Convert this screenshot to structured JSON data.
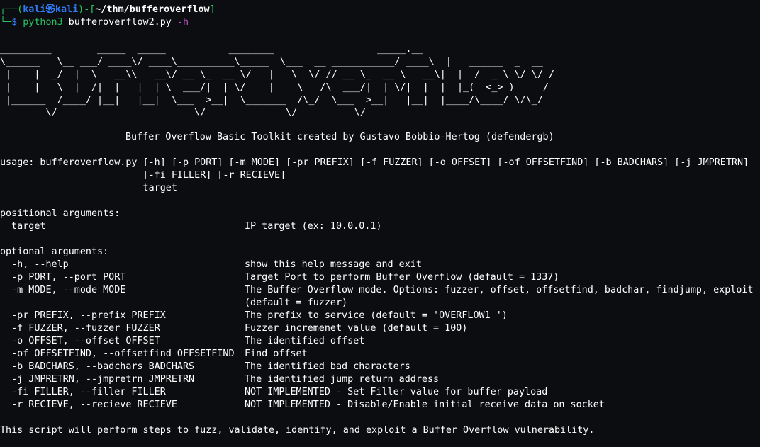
{
  "prompt": {
    "corner_top": "┌──(",
    "user": "kali",
    "at": "㉿",
    "host": "kali",
    "bracket_mid": ")-[",
    "cwd": "~/thm/bufferoverflow",
    "bracket_end": "]",
    "corner_bottom": "└─",
    "dollar": "$",
    "command": "python3",
    "file": "bufferoverflow2.py",
    "flag": "-h"
  },
  "banner": {
    "ascii": [
      "_________        _____  _____           ________                  _____.__",
      "\\______   \\__ ___/ ____\\/ ____\\__________\\_____  \\___  __ ___________/ ____\\  |   ______  _  __",
      " |    |  _/  |  \\   __\\\\   __\\/ __ \\_  __ \\/   |   \\  \\/ // __ \\_  __ \\   __\\|  |  /  _ \\ \\/ \\/ /",
      " |    |   \\  |  /|  |   |  | \\  ___/|  | \\/    |    \\   /\\  ___/|  | \\/|  |  |  |_(  <_> )     /",
      " |______  /____/ |__|   |__|  \\___  >__|  \\_______  /\\_/  \\___  >__|   |__|  |____/\\____/ \\/\\_/",
      "        \\/                        \\/              \\/          \\/"
    ],
    "credit": "Buffer Overflow Basic Toolkit created by Gustavo Bobbio-Hertog (defendergb)"
  },
  "usage": {
    "line1": "usage: bufferoverflow.py [-h] [-p PORT] [-m MODE] [-pr PREFIX] [-f FUZZER] [-o OFFSET] [-of OFFSETFIND] [-b BADCHARS] [-j JMPRETRN]",
    "line2": "                         [-fi FILLER] [-r RECIEVE]",
    "line3": "                         target"
  },
  "positional": {
    "header": "positional arguments:",
    "args": [
      {
        "name": "  target",
        "desc": "IP target (ex: 10.0.0.1)"
      }
    ]
  },
  "optional": {
    "header": "optional arguments:",
    "args": [
      {
        "name": "  -h, --help",
        "desc": "show this help message and exit"
      },
      {
        "name": "  -p PORT, --port PORT",
        "desc": "Target Port to perform Buffer Overflow (default = 1337)"
      },
      {
        "name": "  -m MODE, --mode MODE",
        "desc": "The Buffer Overflow mode. Options: fuzzer, offset, offsetfind, badchar, findjump, exploit"
      },
      {
        "name": "",
        "desc": "(default = fuzzer)"
      },
      {
        "name": "  -pr PREFIX, --prefix PREFIX",
        "desc": "The prefix to service (default = 'OVERFLOW1 ')"
      },
      {
        "name": "  -f FUZZER, --fuzzer FUZZER",
        "desc": "Fuzzer incremenet value (default = 100)"
      },
      {
        "name": "  -o OFFSET, --offset OFFSET",
        "desc": "The identified offset"
      },
      {
        "name": "  -of OFFSETFIND, --offsetfind OFFSETFIND",
        "desc": "Find offset"
      },
      {
        "name": "  -b BADCHARS, --badchars BADCHARS",
        "desc": "The identified bad characters"
      },
      {
        "name": "  -j JMPRETRN, --jmpretrn JMPRETRN",
        "desc": "The identified jump return address"
      },
      {
        "name": "  -fi FILLER, --filler FILLER",
        "desc": "NOT IMPLEMENTED - Set Filler value for buffer payload"
      },
      {
        "name": "  -r RECIEVE, --recieve RECIEVE",
        "desc": "NOT IMPLEMENTED - Disable/Enable initial receive data on socket"
      }
    ]
  },
  "footer": "This script will perform steps to fuzz, validate, identify, and exploit a Buffer Overflow vulnerability."
}
